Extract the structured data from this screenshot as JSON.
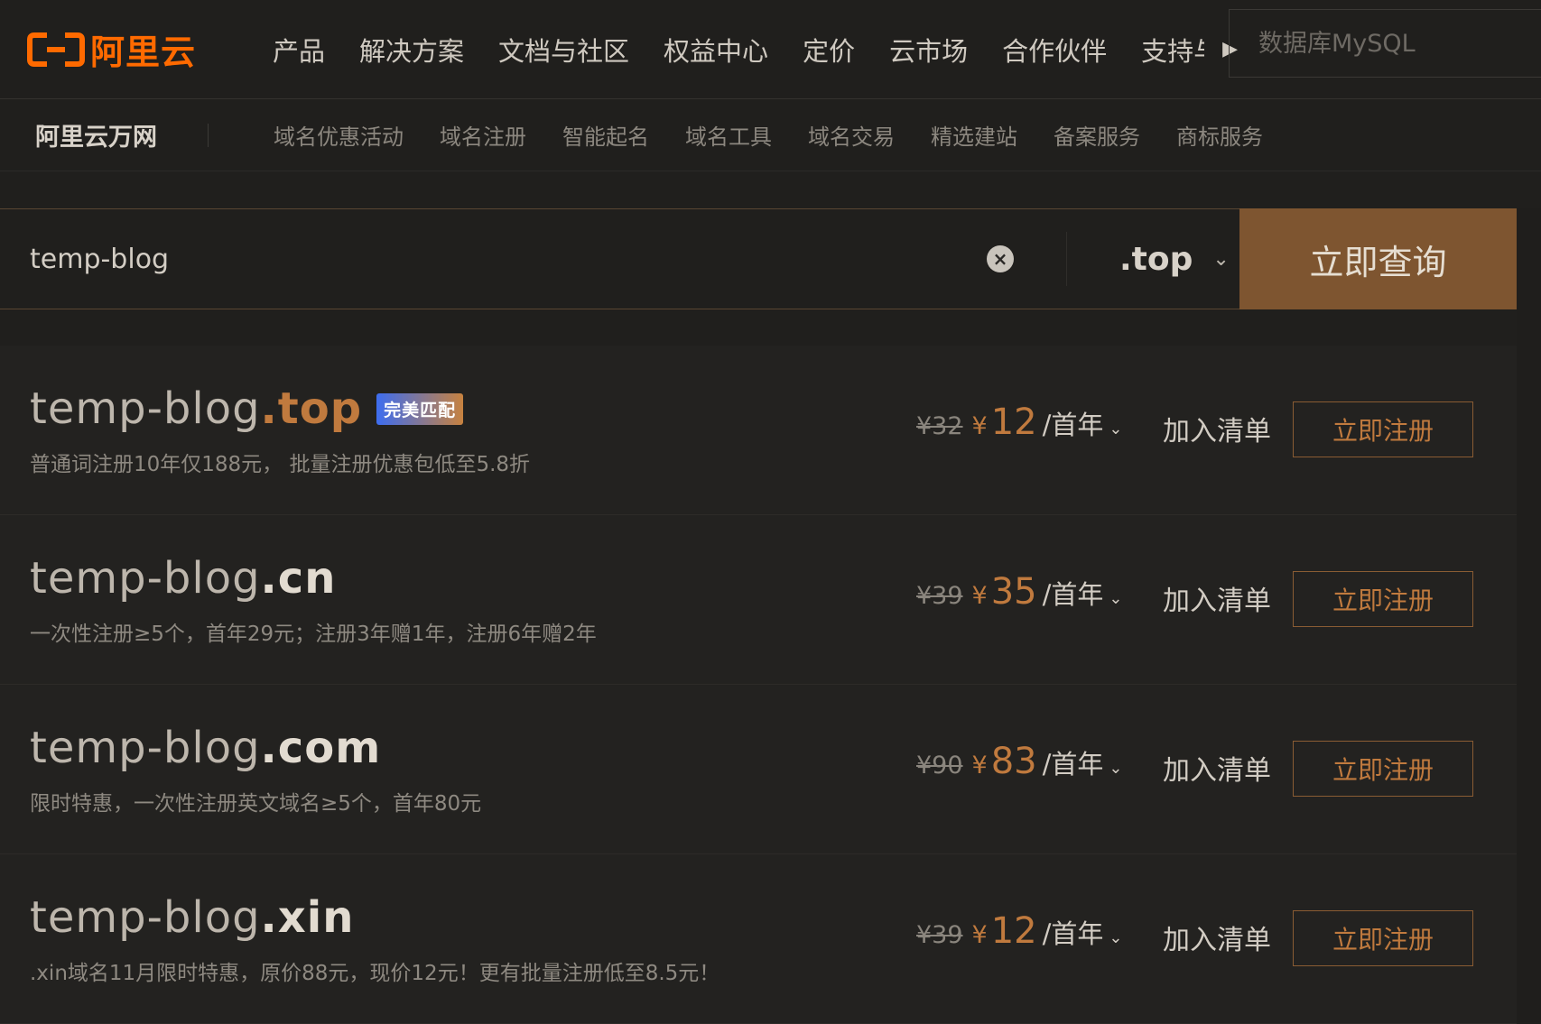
{
  "brand": {
    "logo_text": "阿里云",
    "color": "#ff6a00"
  },
  "nav": {
    "items": [
      "产品",
      "解决方案",
      "文档与社区",
      "权益中心",
      "定价",
      "云市场",
      "合作伙伴",
      "支持与"
    ],
    "more_icon": "caret-right-icon",
    "search_placeholder": "数据库MySQL"
  },
  "subnav": {
    "title": "阿里云万网",
    "items": [
      "域名优惠活动",
      "域名注册",
      "智能起名",
      "域名工具",
      "域名交易",
      "精选建站",
      "备案服务",
      "商标服务"
    ]
  },
  "search": {
    "value": "temp-blog",
    "clear_icon": "clear-icon",
    "tld": ".top",
    "tld_chevron": "chevron-down-icon",
    "submit_label": "立即查询"
  },
  "results": [
    {
      "base": "temp-blog",
      "tld": ".top",
      "badge": "完美匹配",
      "desc": "普通词注册10年仅188元， 批量注册优惠包低至5.8折",
      "orig": "¥32",
      "yen": "¥",
      "price": "12",
      "unit": "/首年",
      "add": "加入清单",
      "register": "立即注册"
    },
    {
      "base": "temp-blog",
      "tld": ".cn",
      "badge": "",
      "desc": "一次性注册≥5个，首年29元；注册3年赠1年，注册6年赠2年",
      "orig": "¥39",
      "yen": "¥",
      "price": "35",
      "unit": "/首年",
      "add": "加入清单",
      "register": "立即注册"
    },
    {
      "base": "temp-blog",
      "tld": ".com",
      "badge": "",
      "desc": "限时特惠，一次性注册英文域名≥5个，首年80元",
      "orig": "¥90",
      "yen": "¥",
      "price": "83",
      "unit": "/首年",
      "add": "加入清单",
      "register": "立即注册"
    },
    {
      "base": "temp-blog",
      "tld": ".xin",
      "badge": "",
      "desc": ".xin域名11月限时特惠，原价88元，现价12元！更有批量注册低至8.5元！",
      "orig": "¥39",
      "yen": "¥",
      "price": "12",
      "unit": "/首年",
      "add": "加入清单",
      "register": "立即注册"
    }
  ]
}
